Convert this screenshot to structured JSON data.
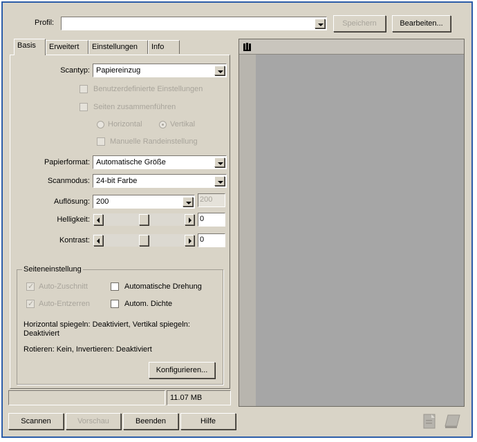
{
  "profile": {
    "label": "Profil:",
    "value": "",
    "save_label": "Speichern",
    "edit_label": "Bearbeiten..."
  },
  "tabs": [
    {
      "label": "Basis"
    },
    {
      "label": "Erweitert"
    },
    {
      "label": "Einstellungen"
    },
    {
      "label": "Info"
    }
  ],
  "basis": {
    "scantype_label": "Scantyp:",
    "scantype_value": "Papiereinzug",
    "custom_settings_label": "Benutzerdefinierte Einstellungen",
    "merge_pages_label": "Seiten zusammenführen",
    "horizontal_label": "Horizontal",
    "vertical_label": "Vertikal",
    "manual_margin_label": "Manuelle Randeinstellung",
    "paper_label": "Papierformat:",
    "paper_value": "Automatische Größe",
    "mode_label": "Scanmodus:",
    "mode_value": "24-bit Farbe",
    "resolution_label": "Auflösung:",
    "resolution_value": "200",
    "resolution_side_value": "200",
    "brightness_label": "Helligkeit:",
    "brightness_value": "0",
    "contrast_label": "Kontrast:",
    "contrast_value": "0",
    "brightness_level": 0.5,
    "contrast_level": 0.5
  },
  "page_settings": {
    "title": "Seiteneinstellung",
    "auto_crop_label": "Auto-Zuschnitt",
    "auto_rotation_label": "Automatische Drehung",
    "auto_deskew_label": "Auto-Entzerren",
    "auto_density_label": "Autom. Dichte",
    "info1": "Horizontal spiegeln: Deaktiviert, Vertikal spiegeln: Deaktiviert",
    "info2": "Rotieren: Kein, Invertieren: Deaktiviert",
    "configure_label": "Konfigurieren..."
  },
  "status": {
    "left_value": "",
    "size_value": "11.07 MB"
  },
  "buttons": {
    "scan": "Scannen",
    "preview": "Vorschau",
    "finish": "Beenden",
    "help": "Hilfe"
  },
  "preview": {
    "tool_icon": "preview-tool-icon"
  }
}
